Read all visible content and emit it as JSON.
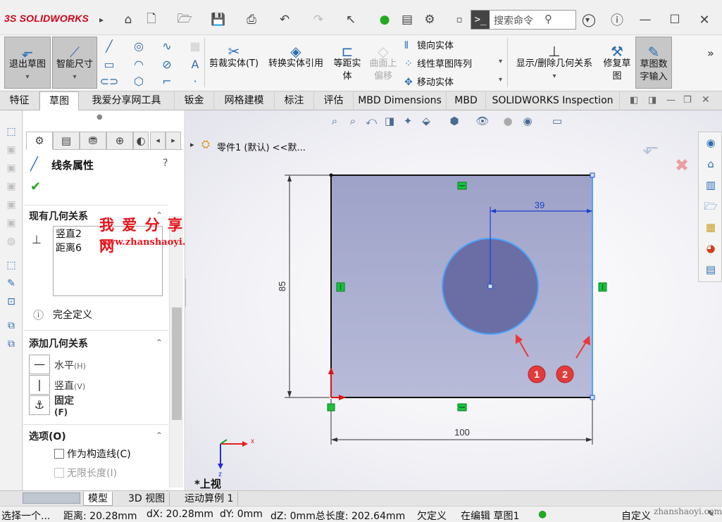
{
  "app": {
    "logo_prefix": "3S",
    "logo_name": "SOLIDWORKS"
  },
  "titlebar": {
    "search_placeholder": "搜索命令",
    "icons": [
      "home-icon",
      "new-file-icon",
      "open-icon",
      "save-icon",
      "print-icon",
      "undo-icon",
      "redo-icon",
      "select-icon",
      "traffic-light-icon",
      "file-props-icon",
      "options-icon",
      "more-icon"
    ],
    "window_controls": [
      "user-icon",
      "help-icon",
      "minimize-icon",
      "maximize-icon",
      "close-icon"
    ]
  },
  "ribbon": {
    "exit_sketch": "退出草图",
    "smart_dim": "智能尺寸",
    "trim": "剪裁实体(T)",
    "convert": "转换实体引用",
    "offset_line1": "等距实",
    "offset_line2": "体",
    "surface_offset_line1": "曲面上",
    "surface_offset_line2": "偏移",
    "mirror": "镜向实体",
    "linear_pattern": "线性草图阵列",
    "move": "移动实体",
    "show_delete_rel": "显示/删除几何关系",
    "repair_line1": "修复草",
    "repair_line2": "图",
    "numeric_line1": "草图数",
    "numeric_line2": "字输入",
    "overflow": "»"
  },
  "tabs": [
    "特征",
    "草图",
    "我爱分享网工具",
    "钣金",
    "网格建模",
    "标注",
    "评估",
    "MBD Dimensions",
    "MBD",
    "SOLIDWORKS Inspection"
  ],
  "active_tab": "草图",
  "property_manager": {
    "title": "线条属性",
    "existing_rel_title": "现有几何关系",
    "existing_relations": [
      "竖直2",
      "距离6"
    ],
    "status": "完全定义",
    "add_rel_title": "添加几何关系",
    "horizontal": "水平",
    "horizontal_key": "(H)",
    "vertical": "竖直",
    "vertical_key": "(V)",
    "fix": "固定",
    "fix_key": "(F)",
    "options_title": "选项(O)",
    "construction": "作为构造线(C)",
    "infinite": "无限长度(I)"
  },
  "watermark": {
    "title": "我 爱 分 享 网",
    "url": "www.zhanshaoyi.com"
  },
  "viewport": {
    "tree_label": "零件1 (默认) <<默...",
    "dim_width": "100",
    "dim_height": "85",
    "dim_39": "39",
    "view_label": "*上视",
    "callout_1": "1",
    "callout_2": "2",
    "axis_x": "x",
    "axis_y": "y",
    "axis_z": "z"
  },
  "bottom_tabs": [
    "模型",
    "3D 视图",
    "运动算例 1"
  ],
  "status": {
    "select": "选择一个...",
    "distance": "距离: 20.28mm",
    "dx": "dX: 20.28mm",
    "dy": "dY: 0mm",
    "dz": "dZ: 0mm总长度: 202.64mm",
    "defined": "欠定义",
    "editing": "在编辑 草图1",
    "custom": "自定义",
    "site": "zhanshaoyi.com"
  }
}
